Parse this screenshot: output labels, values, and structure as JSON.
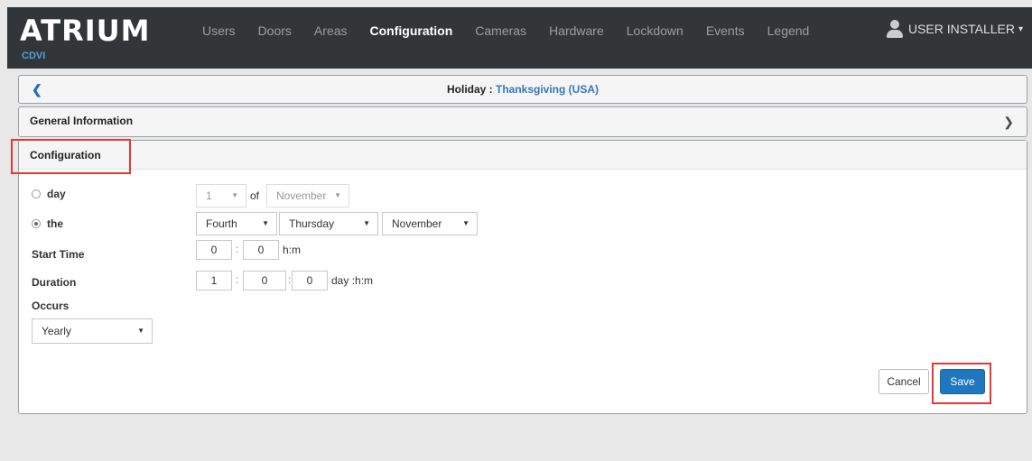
{
  "brand": {
    "logo": "ATRIUM",
    "sub": "CDVI"
  },
  "nav": {
    "items": [
      {
        "label": "Users"
      },
      {
        "label": "Doors"
      },
      {
        "label": "Areas"
      },
      {
        "label": "Configuration",
        "active": true
      },
      {
        "label": "Cameras"
      },
      {
        "label": "Hardware"
      },
      {
        "label": "Lockdown"
      },
      {
        "label": "Events"
      },
      {
        "label": "Legend"
      }
    ],
    "user": "USER INSTALLER"
  },
  "holiday": {
    "label": "Holiday :",
    "name": "Thanksgiving (USA)",
    "back_icon": "chevron-left-icon"
  },
  "general": {
    "title": "General Information",
    "chevron_icon": "chevron-right-icon"
  },
  "config": {
    "title": "Configuration",
    "day_option": {
      "label": "day",
      "checked": false,
      "day_value": "1",
      "of": "of",
      "month_value": "November"
    },
    "the_option": {
      "label": "the",
      "checked": true,
      "ordinal": "Fourth",
      "weekday": "Thursday",
      "month": "November"
    },
    "start_time": {
      "label": "Start Time",
      "hours": "0",
      "minutes": "0",
      "unit": "h:m"
    },
    "duration": {
      "label": "Duration",
      "days": "1",
      "hours": "0",
      "minutes": "0",
      "unit": "day :h:m"
    },
    "occurs": {
      "label": "Occurs",
      "value": "Yearly"
    },
    "separator": ":"
  },
  "buttons": {
    "cancel": "Cancel",
    "save": "Save"
  },
  "colors": {
    "navbar": "#333638",
    "accent": "#1f77bf",
    "highlight": "#e53935",
    "link": "#3477b8"
  }
}
